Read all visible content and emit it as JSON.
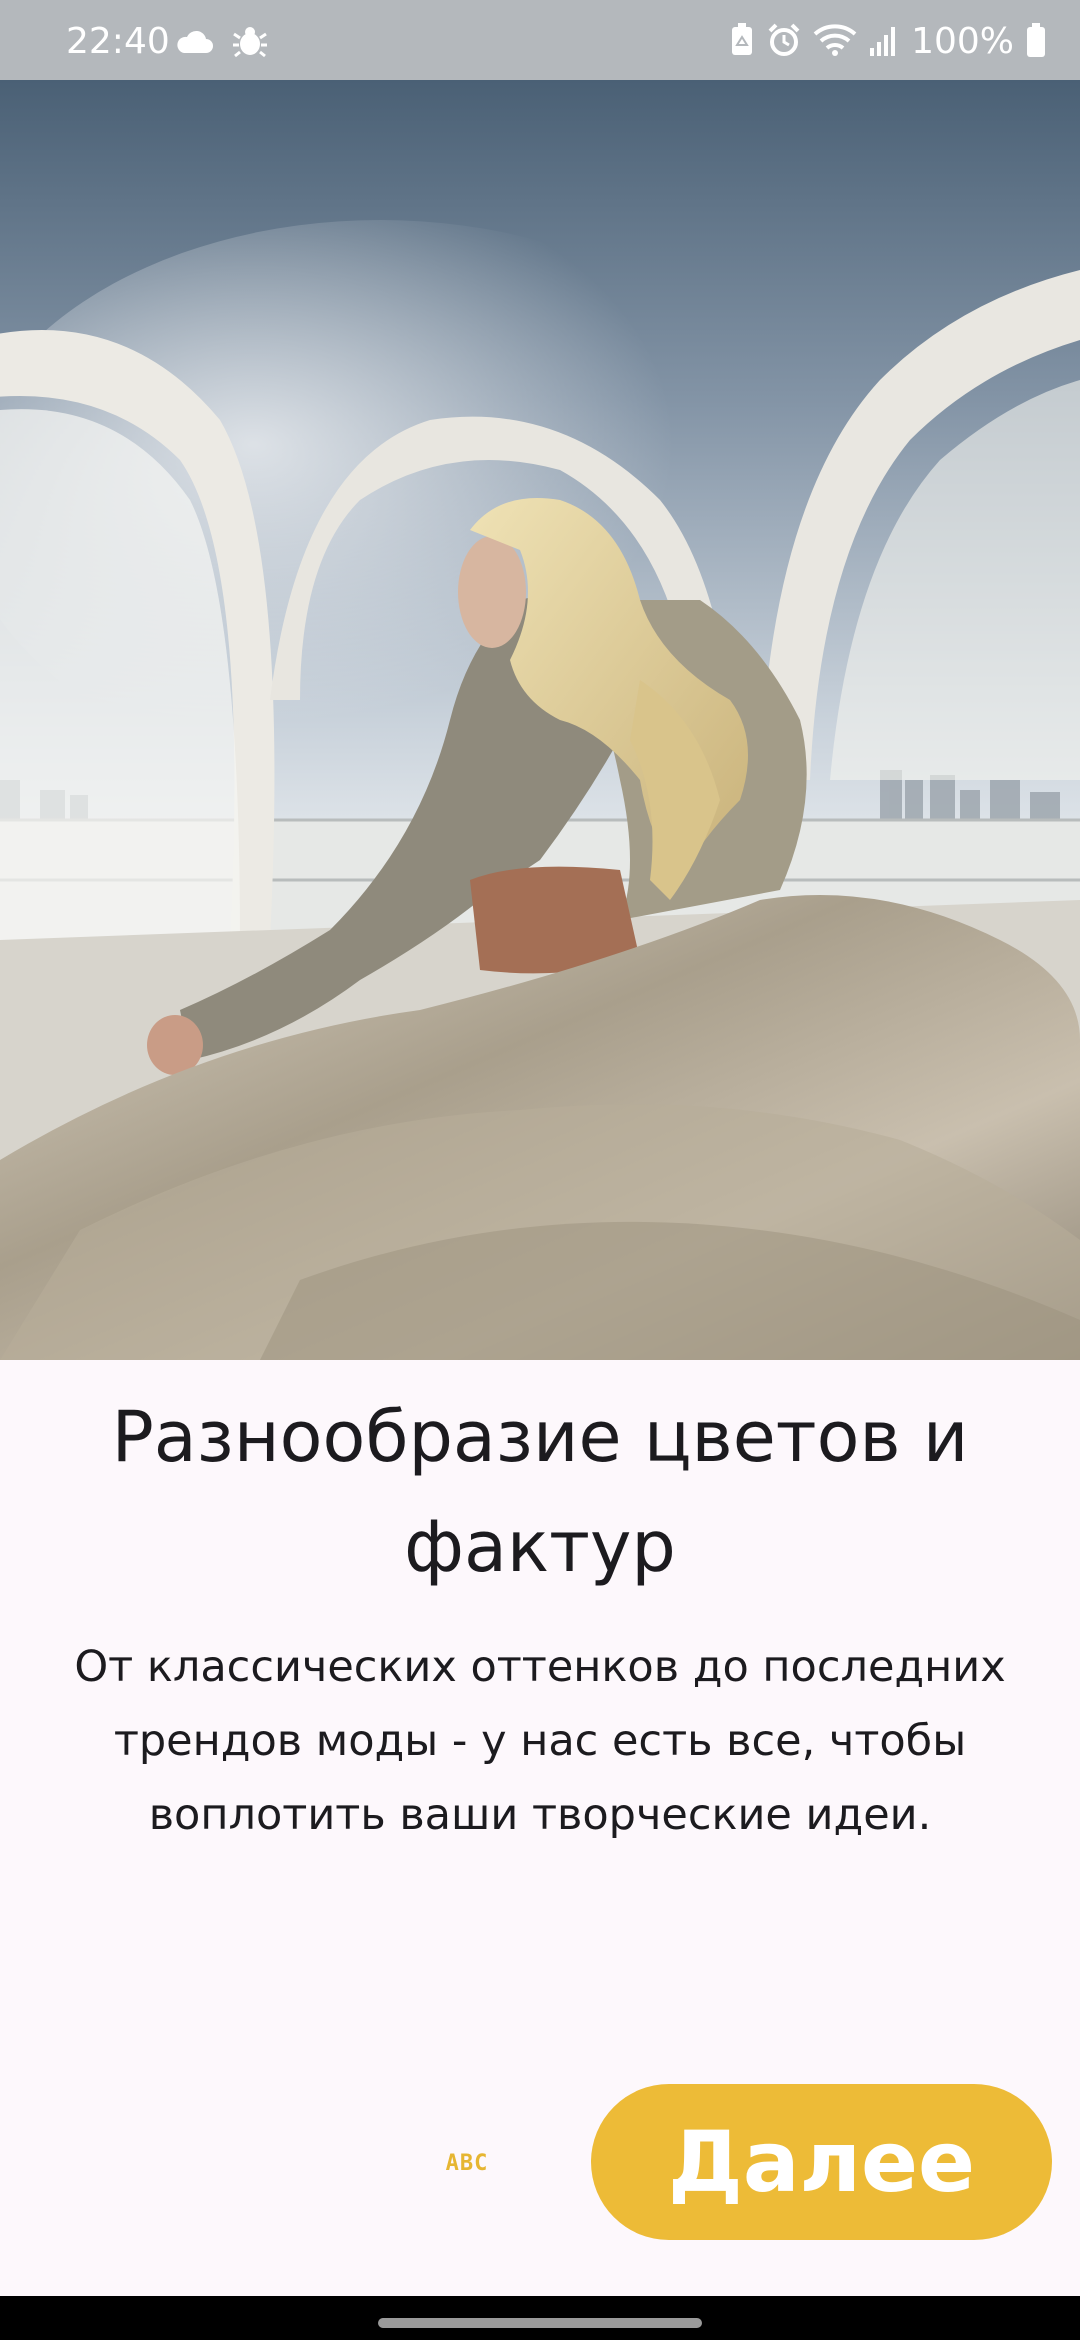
{
  "status_bar": {
    "time": "22:40",
    "left_icons": [
      "cloud-icon",
      "weather-bug-icon"
    ],
    "right_icons": [
      "recycle-battery-icon",
      "alarm-icon",
      "wifi-icon",
      "signal-icon",
      "battery-icon"
    ],
    "battery": "100%"
  },
  "onboarding": {
    "hero_image": "woman-in-headscarf-fabric-photo",
    "title": "Разнообразие цветов и фактур",
    "description": "От классических оттенков до последних трендов моды - у нас есть все, чтобы воплотить ваши творческие идеи.",
    "skip_label": "ABC",
    "next_label": "Далее"
  },
  "colors": {
    "accent": "#edbb37",
    "background": "#fdf8fc",
    "text": "#1c1b1f"
  }
}
